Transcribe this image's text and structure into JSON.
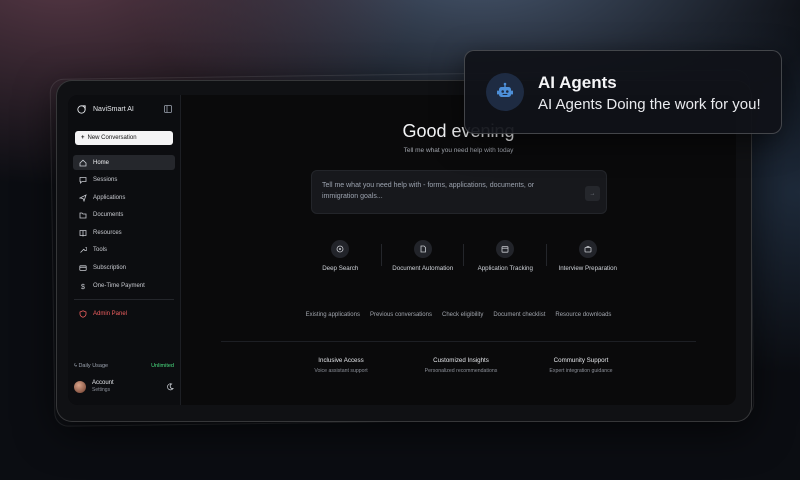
{
  "app": {
    "name": "NaviSmart AI"
  },
  "sidebar": {
    "new_conversation": "New Conversation",
    "items": [
      {
        "label": "Home",
        "icon": "home-icon"
      },
      {
        "label": "Sessions",
        "icon": "chat-icon"
      },
      {
        "label": "Applications",
        "icon": "send-icon"
      },
      {
        "label": "Documents",
        "icon": "folder-icon"
      },
      {
        "label": "Resources",
        "icon": "book-icon"
      },
      {
        "label": "Tools",
        "icon": "wrench-icon"
      },
      {
        "label": "Subscription",
        "icon": "card-icon"
      },
      {
        "label": "One-Time Payment",
        "icon": "dollar-icon"
      }
    ],
    "admin": "Admin Panel",
    "usage_label": "Daily Usage",
    "usage_value": "Unlimited",
    "account_title": "Account",
    "account_sub": "Settings"
  },
  "main": {
    "greeting": "Good evening",
    "subtitle": "Tell me what you need help with today",
    "prompt_placeholder": "Tell me what you need help with - forms, applications, documents, or immigration goals...",
    "features": [
      {
        "label": "Deep Search",
        "icon": "target-icon"
      },
      {
        "label": "Document Automation",
        "icon": "document-icon"
      },
      {
        "label": "Application Tracking",
        "icon": "calendar-icon"
      },
      {
        "label": "Interview Preparation",
        "icon": "briefcase-icon"
      }
    ],
    "links": [
      "Existing applications",
      "Previous conversations",
      "Check eligibility",
      "Document checklist",
      "Resource downloads"
    ],
    "footer": [
      {
        "title": "Inclusive Access",
        "desc": "Voice assistant support"
      },
      {
        "title": "Customized Insights",
        "desc": "Personalized recommendations"
      },
      {
        "title": "Community Support",
        "desc": "Expert integration guidance"
      }
    ]
  },
  "callout": {
    "title": "AI Agents",
    "subtitle": "AI Agents Doing the work for you!",
    "icon": "robot-icon"
  },
  "colors": {
    "accent_admin": "#ef5f5f",
    "usage_unlimited": "#4ade80",
    "bot_badge": "#1e2b42"
  }
}
